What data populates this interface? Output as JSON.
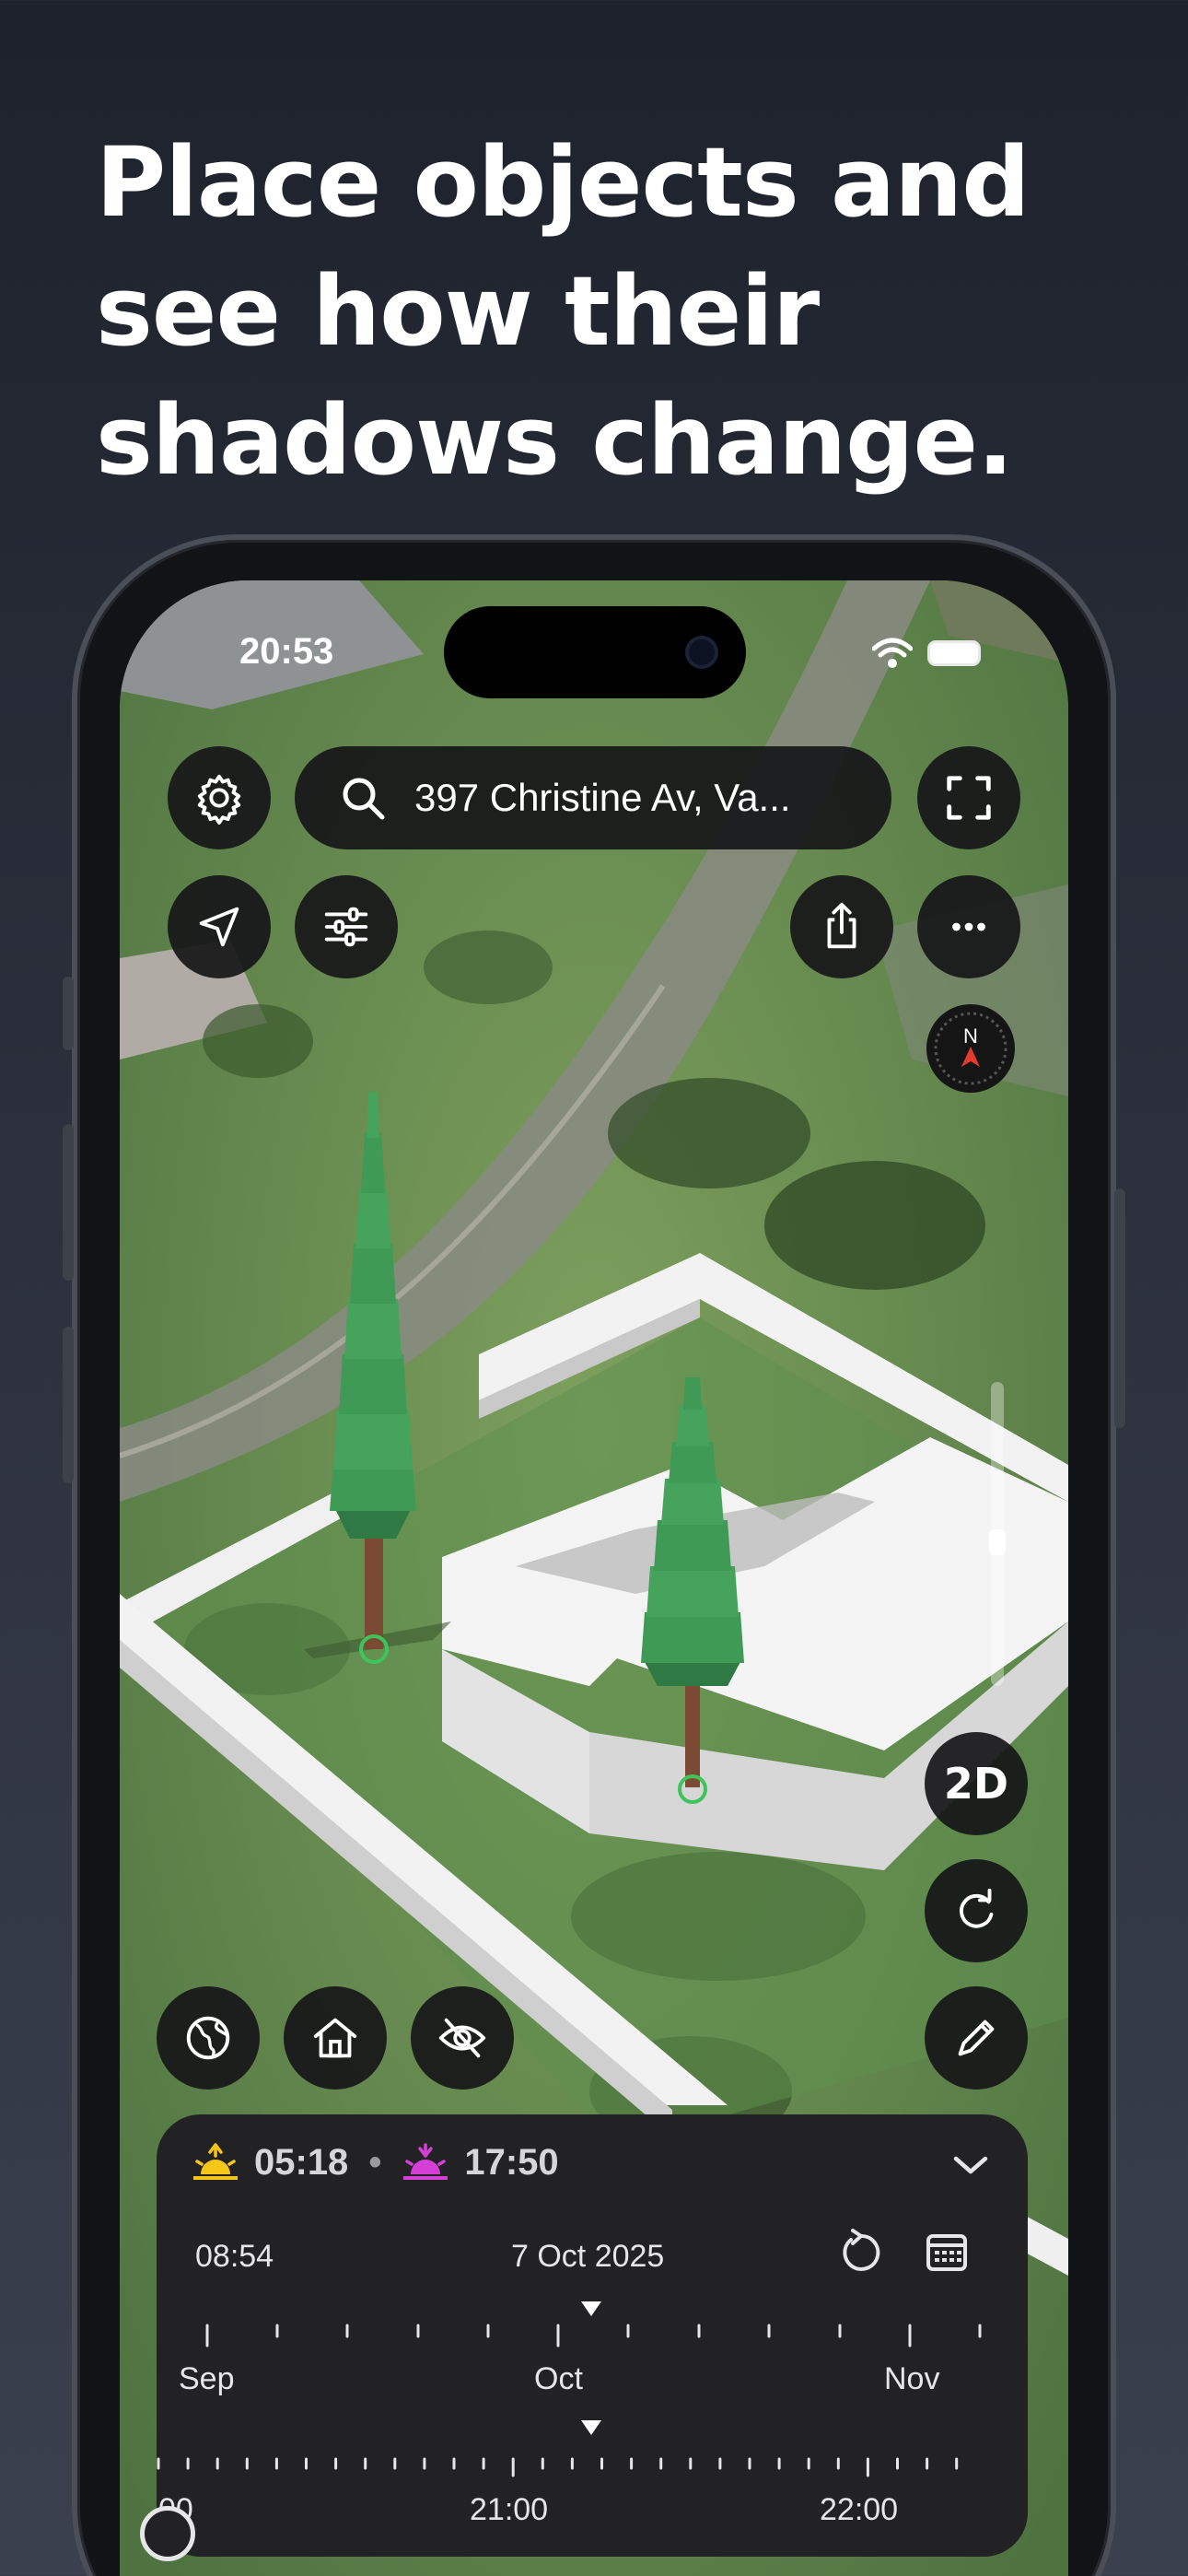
{
  "headline": "Place objects and see how their shadows change.",
  "status_bar": {
    "time": "20:53"
  },
  "search": {
    "address": "397 Christine Av, Va..."
  },
  "map_controls": {
    "view_mode_label": "2D"
  },
  "compass": {
    "label": "N"
  },
  "sun_panel": {
    "sunrise": "05:18",
    "separator": "•",
    "sunset": "17:50",
    "current_time": "08:54",
    "date": "7 Oct 2025",
    "months": [
      "Sep",
      "Oct",
      "Nov"
    ],
    "hours": [
      "00",
      "21:00",
      "22:00"
    ]
  },
  "colors": {
    "accent_sunrise": "#f5c518",
    "accent_sunset": "#d63fd6",
    "button_bg": "#161618",
    "panel_bg": "#222224",
    "tree_green": "#3f9a55",
    "compass_needle": "#e23b2e"
  }
}
